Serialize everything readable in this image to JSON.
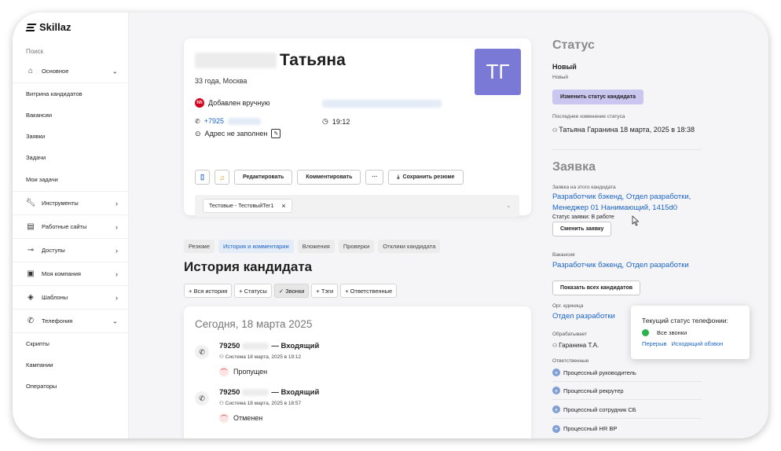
{
  "brand": {
    "logo_text": "Skillaz"
  },
  "sidebar": {
    "search_label": "Поиск",
    "items": [
      {
        "label": "Основное",
        "icon": "home-icon",
        "chevron": "down"
      },
      {
        "label": "Витрина кандидатов"
      },
      {
        "label": "Вакансии"
      },
      {
        "label": "Заявки"
      },
      {
        "label": "Задачи"
      },
      {
        "label": "Мои задачи"
      },
      {
        "label": "Инструменты",
        "icon": "wrench-icon",
        "chevron": "right"
      },
      {
        "label": "Работные сайты",
        "icon": "document-icon",
        "chevron": "right"
      },
      {
        "label": "Доступы",
        "icon": "key-icon",
        "chevron": "right"
      },
      {
        "label": "Моя компания",
        "icon": "briefcase-icon",
        "chevron": "right"
      },
      {
        "label": "Шаблоны",
        "icon": "layers-icon",
        "chevron": "right"
      },
      {
        "label": "Телефония",
        "icon": "phone-icon",
        "chevron": "down"
      },
      {
        "label": "Скрипты"
      },
      {
        "label": "Кампании"
      },
      {
        "label": "Операторы"
      }
    ]
  },
  "profile": {
    "first_name": "Татьяна",
    "age_city": "33 года, Москва",
    "avatar_initials": "ТГ",
    "avatar_color": "#7b79d6",
    "source": "Добавлен вручную",
    "phone": "+7925",
    "time": "19:12",
    "address": "Адрес не заполнен",
    "buttons": {
      "edit": "Редактировать",
      "comment": "Комментировать",
      "more": "···",
      "save_resume": "Сохранить резюме"
    },
    "tag": "Тестовые - ТестовыйТег1"
  },
  "tabs": [
    "Резюме",
    "История и комментарии",
    "Вложения",
    "Проверки",
    "Отклики кандидата"
  ],
  "history": {
    "title": "История кандидата",
    "filters": [
      "+ Вся история",
      "+ Статусы",
      "✓ Звонки",
      "+ Тэги",
      "+ Ответственные"
    ],
    "day": "Сегодня, 18 марта 2025",
    "calls": [
      {
        "number": "79250",
        "direction": "— Входящий",
        "meta": "Система 18 марта, 2025 в 19:12",
        "status": "Пропущен"
      },
      {
        "number": "79250",
        "direction": "— Входящий",
        "meta": "Система 18 марта, 2025 в 18:57",
        "status": "Отменен"
      }
    ]
  },
  "status_panel": {
    "title": "Статус",
    "status": "Новый",
    "substatus": "Новый",
    "change_button": "Изменить статус кандидата",
    "last_change_label": "Последнее изменение статуса",
    "last_change_value": "Татьяна Гаранина  18 марта, 2025 в 18:38"
  },
  "request_panel": {
    "title": "Заявка",
    "for_candidate_label": "Заявка на этого кандидата",
    "request_link": "Разработчик бэкенд, Отдел разработки, Менеджер 01 Нанимающий, 1415d0",
    "request_status": "Статус заявки: В работе",
    "change_request_button": "Сменить заявку",
    "vacancy_label": "Вакансия",
    "vacancy_link": "Разработчик бэкенд, Отдел разработки",
    "show_all_button": "Показать всех кандидатов",
    "org_unit_label": "Орг. единица",
    "org_unit_link": "Отдел разработки",
    "handler_label": "Обрабатывает",
    "handler_value": "Гаранина Т.А.",
    "responsible_label": "Ответственные",
    "responsible": [
      "Процессный руководитель",
      "Процессный рекрутер",
      "Процессный сотрудник СБ",
      "Процессный HR BP"
    ]
  },
  "telephony_popup": {
    "title": "Текущий статус телефонии:",
    "status": "Все звонки",
    "status_color": "#2bb24c",
    "link_break": "Перерыв",
    "link_outgoing": "Исходящий обзвон"
  }
}
